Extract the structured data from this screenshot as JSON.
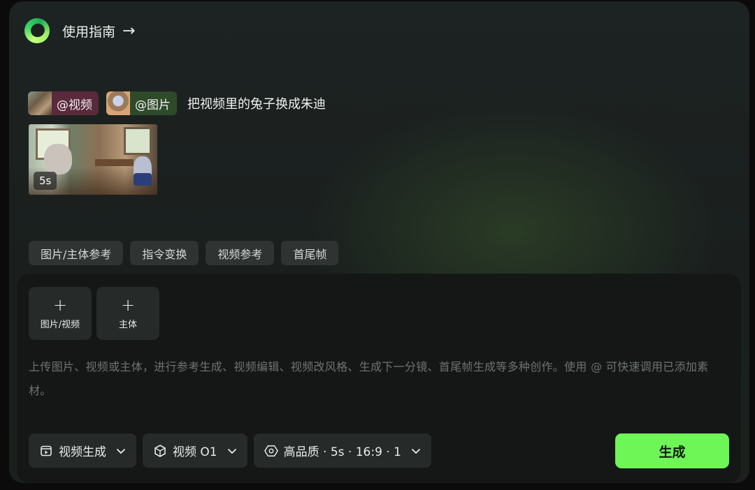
{
  "header": {
    "guide_label": "使用指南"
  },
  "prompt": {
    "video_chip": "@视频",
    "image_chip": "@图片",
    "text": "把视频里的兔子换成朱迪"
  },
  "video_preview": {
    "duration": "5s"
  },
  "tabs": [
    "图片/主体参考",
    "指令变换",
    "视频参考",
    "首尾帧"
  ],
  "upload": {
    "media_label": "图片/视频",
    "subject_label": "主体"
  },
  "input": {
    "placeholder": "上传图片、视频或主体，进行参考生成、视频编辑、视频改风格、生成下一分镜、首尾帧生成等多种创作。使用 @ 可快速调用已添加素材。"
  },
  "controls": {
    "mode": "视频生成",
    "model": "视频 O1",
    "settings": "高品质 · 5s · 16:9 · 1",
    "generate": "生成"
  },
  "colors": {
    "accent": "#6ef556",
    "video_chip": "#5a2a3c",
    "image_chip": "#2f4a2a"
  }
}
